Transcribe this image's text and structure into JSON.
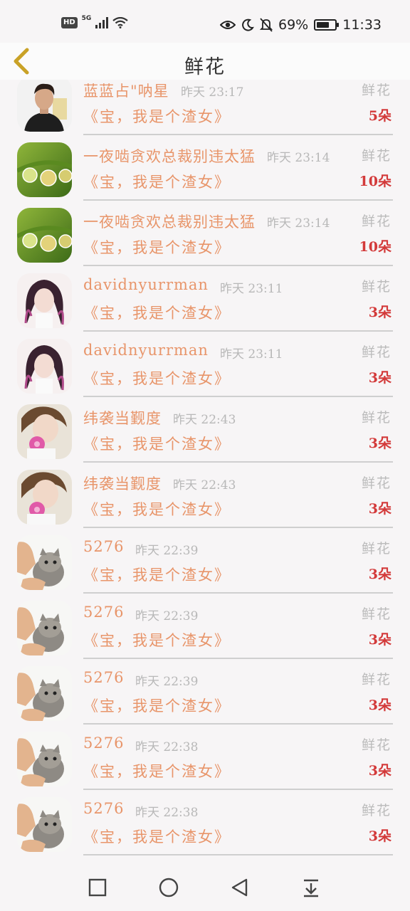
{
  "status_bar": {
    "hd": "HD",
    "network": "5G",
    "battery_pct": "69%",
    "battery_level": 0.69,
    "time": "11:33",
    "icons": [
      "eye-icon",
      "moon-icon",
      "bell-off-icon",
      "battery-icon"
    ]
  },
  "nav": {
    "title": "鲜花",
    "back_icon": "chevron-left-icon"
  },
  "rows": [
    {
      "name": "蓝蓝占\"呐星",
      "time": "昨天  23:17",
      "gift": "鲜花",
      "book": "《宝，我是个渣女》",
      "count": "5朵",
      "avatar": "man"
    },
    {
      "name": "一夜啮贪欢总裁别违太猛",
      "time": "昨天  23:14",
      "gift": "鲜花",
      "book": "《宝，我是个渣女》",
      "count": "10朵",
      "avatar": "drops"
    },
    {
      "name": "一夜啮贪欢总裁别违太猛",
      "time": "昨天  23:14",
      "gift": "鲜花",
      "book": "《宝，我是个渣女》",
      "count": "10朵",
      "avatar": "drops"
    },
    {
      "name": "davidnyurrman",
      "time": "昨天  23:11",
      "gift": "鲜花",
      "book": "《宝，我是个渣女》",
      "count": "3朵",
      "avatar": "girl"
    },
    {
      "name": "davidnyurrman",
      "time": "昨天  23:11",
      "gift": "鲜花",
      "book": "《宝，我是个渣女》",
      "count": "3朵",
      "avatar": "girl"
    },
    {
      "name": "纬袭当觐度",
      "time": "昨天  22:43",
      "gift": "鲜花",
      "book": "《宝，我是个渣女》",
      "count": "3朵",
      "avatar": "flower"
    },
    {
      "name": "纬袭当觐度",
      "time": "昨天  22:43",
      "gift": "鲜花",
      "book": "《宝，我是个渣女》",
      "count": "3朵",
      "avatar": "flower"
    },
    {
      "name": "5276",
      "time": "昨天  22:39",
      "gift": "鲜花",
      "book": "《宝，我是个渣女》",
      "count": "3朵",
      "avatar": "cat"
    },
    {
      "name": "5276",
      "time": "昨天  22:39",
      "gift": "鲜花",
      "book": "《宝，我是个渣女》",
      "count": "3朵",
      "avatar": "cat"
    },
    {
      "name": "5276",
      "time": "昨天  22:39",
      "gift": "鲜花",
      "book": "《宝，我是个渣女》",
      "count": "3朵",
      "avatar": "cat"
    },
    {
      "name": "5276",
      "time": "昨天  22:38",
      "gift": "鲜花",
      "book": "《宝，我是个渣女》",
      "count": "3朵",
      "avatar": "cat"
    },
    {
      "name": "5276",
      "time": "昨天  22:38",
      "gift": "鲜花",
      "book": "《宝，我是个渣女》",
      "count": "3朵",
      "avatar": "cat"
    }
  ],
  "system_nav": [
    "square-icon",
    "circle-icon",
    "triangle-back-icon",
    "download-icon"
  ],
  "colors": {
    "name": "#e8956a",
    "count": "#d33a3a",
    "muted": "#b8b8b8",
    "back": "#c9a227"
  }
}
